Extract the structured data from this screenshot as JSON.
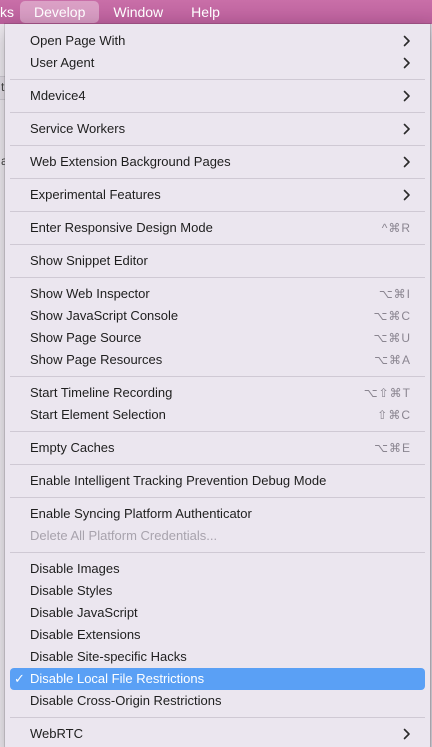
{
  "menubar": {
    "items": [
      {
        "label": "ks"
      },
      {
        "label": "Develop"
      },
      {
        "label": "Window"
      },
      {
        "label": "Help"
      }
    ]
  },
  "window": {
    "glyph_a": "t,",
    "glyph_b": "a"
  },
  "menu": {
    "groups": [
      [
        {
          "label": "Open Page With",
          "submenu": true
        },
        {
          "label": "User Agent",
          "submenu": true
        }
      ],
      [
        {
          "label": "Mdevice4",
          "submenu": true
        }
      ],
      [
        {
          "label": "Service Workers",
          "submenu": true
        }
      ],
      [
        {
          "label": "Web Extension Background Pages",
          "submenu": true
        }
      ],
      [
        {
          "label": "Experimental Features",
          "submenu": true
        }
      ],
      [
        {
          "label": "Enter Responsive Design Mode",
          "shortcut": "^⌘R"
        }
      ],
      [
        {
          "label": "Show Snippet Editor"
        }
      ],
      [
        {
          "label": "Show Web Inspector",
          "shortcut": "⌥⌘I"
        },
        {
          "label": "Show JavaScript Console",
          "shortcut": "⌥⌘C"
        },
        {
          "label": "Show Page Source",
          "shortcut": "⌥⌘U"
        },
        {
          "label": "Show Page Resources",
          "shortcut": "⌥⌘A"
        }
      ],
      [
        {
          "label": "Start Timeline Recording",
          "shortcut": "⌥⇧⌘T"
        },
        {
          "label": "Start Element Selection",
          "shortcut": "⇧⌘C"
        }
      ],
      [
        {
          "label": "Empty Caches",
          "shortcut": "⌥⌘E"
        }
      ],
      [
        {
          "label": "Enable Intelligent Tracking Prevention Debug Mode"
        }
      ],
      [
        {
          "label": "Enable Syncing Platform Authenticator"
        },
        {
          "label": "Delete All Platform Credentials...",
          "disabled": true
        }
      ],
      [
        {
          "label": "Disable Images"
        },
        {
          "label": "Disable Styles"
        },
        {
          "label": "Disable JavaScript"
        },
        {
          "label": "Disable Extensions"
        },
        {
          "label": "Disable Site-specific Hacks"
        },
        {
          "label": "Disable Local File Restrictions",
          "checked": true,
          "selected": true,
          "check": "✓"
        },
        {
          "label": "Disable Cross-Origin Restrictions"
        }
      ],
      [
        {
          "label": "WebRTC",
          "submenu": true
        }
      ]
    ]
  },
  "colors": {
    "menubar": "#c96fa8",
    "selection": "#5aa0f5",
    "menu_bg": "#ebe6ef"
  }
}
